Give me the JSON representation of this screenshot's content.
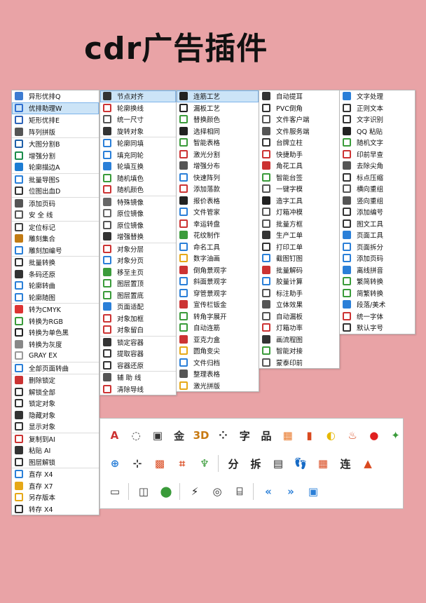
{
  "title": "cdr广告插件",
  "col1": [
    {
      "label": "异形优排Q",
      "icon": "shape-icon",
      "color": "#3d7bd1"
    },
    {
      "label": "优排助理W",
      "icon": "sort-assist-icon",
      "color": "#2f6fd0",
      "sel": true
    },
    {
      "label": "矩形优排E",
      "icon": "rect-sort-icon",
      "color": "#2d63b8"
    },
    {
      "label": "阵列拼版",
      "icon": "array-icon",
      "color": "#555"
    },
    {
      "label": "大图分割B",
      "icon": "split-icon",
      "color": "#1f5fa8"
    },
    {
      "label": "增强分割",
      "icon": "enhanced-split-icon",
      "color": "#1a8c4a"
    },
    {
      "label": "轮廓描边A",
      "icon": "outline-icon",
      "color": "#1d7cd3"
    },
    {
      "label": "批量导图S",
      "icon": "export-icon",
      "color": "#2a7fd8"
    },
    {
      "label": "位图出血D",
      "icon": "bleed-icon",
      "color": "#333"
    },
    {
      "label": "添加页码",
      "icon": "page-number-icon",
      "color": "#555"
    },
    {
      "label": "安 全 线",
      "icon": "safe-line-icon",
      "color": "#555"
    },
    {
      "label": "定位标记",
      "icon": "target-icon",
      "color": "#444"
    },
    {
      "label": "雕刻集合",
      "icon": "engrave-icon",
      "color": "#c27b13"
    },
    {
      "label": "雕刻加编号",
      "icon": "engrave-number-icon",
      "color": "#2a7fd8"
    },
    {
      "label": "批量转换",
      "icon": "batch-convert-icon",
      "color": "#333"
    },
    {
      "label": "条码还原",
      "icon": "barcode-icon",
      "color": "#333"
    },
    {
      "label": "轮廓转曲",
      "icon": "curve-icon",
      "color": "#2a7fd8"
    },
    {
      "label": "轮廓随图",
      "icon": "follow-icon",
      "color": "#2a7fd8"
    },
    {
      "label": "转为CMYK",
      "icon": "cmyk-icon",
      "color": "#d33"
    },
    {
      "label": "转换为RGB",
      "icon": "rgb-icon",
      "color": "#3a9b3a"
    },
    {
      "label": "转换为单色黑",
      "icon": "mono-icon",
      "color": "#222"
    },
    {
      "label": "转换为灰度",
      "icon": "gray-icon",
      "color": "#888"
    },
    {
      "label": "GRAY  EX",
      "icon": "gray-ex-icon",
      "color": "#999"
    },
    {
      "label": "全部页面转曲",
      "icon": "all-pages-icon",
      "color": "#2a7fd8"
    },
    {
      "label": "删除锁定",
      "icon": "delete-lock-icon",
      "color": "#c33"
    },
    {
      "label": "解锁全部",
      "icon": "unlock-icon",
      "color": "#333"
    },
    {
      "label": "锁定对象",
      "icon": "lock-icon",
      "color": "#333"
    },
    {
      "label": "隐藏对象",
      "icon": "hide-icon",
      "color": "#333"
    },
    {
      "label": "显示对象",
      "icon": "show-icon",
      "color": "#333"
    },
    {
      "label": "复制到AI",
      "icon": "copy-ai-icon",
      "color": "#c33"
    },
    {
      "label": "粘贴   AI",
      "icon": "paste-ai-icon",
      "color": "#333"
    },
    {
      "label": "图层解锁",
      "icon": "layer-unlock-icon",
      "color": "#333"
    },
    {
      "label": "直存 X4",
      "icon": "save-x4-icon",
      "color": "#2a7fd8"
    },
    {
      "label": "直存 X7",
      "icon": "save-x7-icon",
      "color": "#e6a817"
    },
    {
      "label": "另存版本",
      "icon": "save-as-icon",
      "color": "#e6a817"
    },
    {
      "label": "转存 X4",
      "icon": "resave-icon",
      "color": "#333"
    }
  ],
  "col2": [
    {
      "label": "节点对齐",
      "icon": "node-align-icon",
      "color": "#333",
      "sel": true
    },
    {
      "label": "轮廓换线",
      "icon": "outline-swap-icon",
      "color": "#c33"
    },
    {
      "label": "统一尺寸",
      "icon": "same-size-icon",
      "color": "#555"
    },
    {
      "label": "旋转对象",
      "icon": "rotate-icon",
      "color": "#333"
    },
    {
      "label": "轮廓同填",
      "icon": "fill-icon",
      "color": "#2a7fd8"
    },
    {
      "label": "填充同轮",
      "icon": "fill-outline-icon",
      "color": "#2a7fd8"
    },
    {
      "label": "轮填互换",
      "icon": "swap-icon",
      "color": "#2a7fd8"
    },
    {
      "label": "随机填色",
      "icon": "random-fill-icon",
      "color": "#3a9b3a"
    },
    {
      "label": "随机颜色",
      "icon": "random-color-icon",
      "color": "#c33"
    },
    {
      "label": "特殊镜像",
      "icon": "mirror-icon",
      "color": "#666"
    },
    {
      "label": "原位镜像",
      "icon": "mirror-inplace-icon",
      "color": "#666"
    },
    {
      "label": "原位镜像",
      "icon": "mirror-inplace-icon",
      "color": "#555"
    },
    {
      "label": "增强替换",
      "icon": "replace-icon",
      "color": "#333"
    },
    {
      "label": "对象分层",
      "icon": "layer-split-icon",
      "color": "#c33"
    },
    {
      "label": "对象分页",
      "icon": "page-split-icon",
      "color": "#2a7fd8"
    },
    {
      "label": "移至主页",
      "icon": "move-master-icon",
      "color": "#3a9b3a"
    },
    {
      "label": "图层置顶",
      "icon": "layer-top-icon",
      "color": "#3a9b3a"
    },
    {
      "label": "图层置底",
      "icon": "layer-bottom-icon",
      "color": "#3a9b3a"
    },
    {
      "label": "页面适配",
      "icon": "page-fit-icon",
      "color": "#2a7fd8"
    },
    {
      "label": "对象加框",
      "icon": "frame-icon",
      "color": "#c33"
    },
    {
      "label": "对象留白",
      "icon": "margin-icon",
      "color": "#c33"
    },
    {
      "label": "锁定容器",
      "icon": "lock-container-icon",
      "color": "#333"
    },
    {
      "label": "提取容器",
      "icon": "extract-container-icon",
      "color": "#333"
    },
    {
      "label": "容器还原",
      "icon": "restore-container-icon",
      "color": "#333"
    },
    {
      "label": "辅 助 线",
      "icon": "guide-icon",
      "color": "#555"
    },
    {
      "label": "清除导线",
      "icon": "clear-guide-icon",
      "color": "#c33"
    }
  ],
  "col3": [
    {
      "label": "连筋工艺",
      "icon": "rib-icon",
      "color": "#222",
      "sel": true
    },
    {
      "label": "漏板工艺",
      "icon": "stencil-icon",
      "color": "#222"
    },
    {
      "label": "替换颜色",
      "icon": "replace-color-icon",
      "color": "#3a9b3a"
    },
    {
      "label": "选择相同",
      "icon": "select-same-icon",
      "color": "#222"
    },
    {
      "label": "智能表格",
      "icon": "table-icon",
      "color": "#3a9b3a"
    },
    {
      "label": "激光分割",
      "icon": "laser-split-icon",
      "color": "#c33"
    },
    {
      "label": "增强分布",
      "icon": "distribute-icon",
      "color": "#555"
    },
    {
      "label": "快速阵列",
      "icon": "quick-array-icon",
      "color": "#2a7fd8"
    },
    {
      "label": "添加落款",
      "icon": "signature-icon",
      "color": "#c33"
    },
    {
      "label": "报价表格",
      "icon": "quote-icon",
      "color": "#222"
    },
    {
      "label": "文件管家",
      "icon": "file-manager-icon",
      "color": "#2a7fd8"
    },
    {
      "label": "幸运转盘",
      "icon": "wheel-icon",
      "color": "#c33"
    },
    {
      "label": "花纹制作",
      "icon": "pattern-icon",
      "color": "#3a9b3a"
    },
    {
      "label": "命名工具",
      "icon": "name-tool-icon",
      "color": "#2a7fd8"
    },
    {
      "label": "数字油画",
      "icon": "paint-icon",
      "color": "#e6a817"
    },
    {
      "label": "倒角景观字",
      "icon": "bevel-text-icon",
      "color": "#c33"
    },
    {
      "label": "斜面景观字",
      "icon": "slope-text-icon",
      "color": "#2a7fd8"
    },
    {
      "label": "穿管景观字",
      "icon": "pipe-text-icon",
      "color": "#2a7fd8"
    },
    {
      "label": "宣传栏钣金",
      "icon": "sheet-metal-icon",
      "color": "#c33"
    },
    {
      "label": "转角字展开",
      "icon": "corner-text-icon",
      "color": "#3a9b3a"
    },
    {
      "label": "自动连筋",
      "icon": "auto-rib-icon",
      "color": "#3a9b3a"
    },
    {
      "label": "亚克力盒",
      "icon": "acrylic-icon",
      "color": "#c33"
    },
    {
      "label": "圆角变尖",
      "icon": "round-corner-icon",
      "color": "#e6a817"
    },
    {
      "label": "文件归档",
      "icon": "archive-icon",
      "color": "#2a7fd8"
    },
    {
      "label": "整理表格",
      "icon": "sort-table-icon",
      "color": "#555"
    },
    {
      "label": "激光拼版",
      "icon": "laser-layout-icon",
      "color": "#e6a817"
    }
  ],
  "col4": [
    {
      "label": "自动提耳",
      "icon": "auto-ear-icon",
      "color": "#333"
    },
    {
      "label": "PVC倒角",
      "icon": "pvc-icon",
      "color": "#333"
    },
    {
      "label": "文件客户端",
      "icon": "client-icon",
      "color": "#555"
    },
    {
      "label": "文件服务端",
      "icon": "server-icon",
      "color": "#555"
    },
    {
      "label": "台牌立柱",
      "icon": "pillar-icon",
      "color": "#333"
    },
    {
      "label": "快捷助手",
      "icon": "assistant-icon",
      "color": "#c33"
    },
    {
      "label": "角花工具",
      "icon": "corner-flower-icon",
      "color": "#c33"
    },
    {
      "label": "智能台签",
      "icon": "table-card-icon",
      "color": "#3a9b3a"
    },
    {
      "label": "一键字模",
      "icon": "font-mold-icon",
      "color": "#555"
    },
    {
      "label": "造字工具",
      "icon": "font-tool-icon",
      "color": "#222"
    },
    {
      "label": "灯箱冲模",
      "icon": "lightbox-icon",
      "color": "#555"
    },
    {
      "label": "批量方框",
      "icon": "batch-box-icon",
      "color": "#555"
    },
    {
      "label": "生产工单",
      "icon": "work-order-icon",
      "color": "#333"
    },
    {
      "label": "打印工单",
      "icon": "print-order-icon",
      "color": "#333"
    },
    {
      "label": "截图钉图",
      "icon": "screenshot-icon",
      "color": "#2a7fd8"
    },
    {
      "label": "批量解码",
      "icon": "decode-icon",
      "color": "#c33"
    },
    {
      "label": "胶量计算",
      "icon": "glue-icon",
      "color": "#2a7fd8"
    },
    {
      "label": "标注助手",
      "icon": "annotate-icon",
      "color": "#555"
    },
    {
      "label": "立体效果",
      "icon": "3d-icon",
      "color": "#555"
    },
    {
      "label": "自动漏板",
      "icon": "auto-stencil-icon",
      "color": "#555"
    },
    {
      "label": "灯箱功率",
      "icon": "power-icon",
      "color": "#c33"
    },
    {
      "label": "画流程图",
      "icon": "flowchart-icon",
      "color": "#333"
    },
    {
      "label": "智能对接",
      "icon": "connect-icon",
      "color": "#3a9b3a"
    },
    {
      "label": "蒙泰印前",
      "icon": "prepress-icon",
      "color": "#555"
    }
  ],
  "col5": [
    {
      "label": "文字处理",
      "icon": "text-process-icon",
      "color": "#2a7fd8"
    },
    {
      "label": "正则文本",
      "icon": "regex-icon",
      "color": "#333"
    },
    {
      "label": "文字识别",
      "icon": "ocr-icon",
      "color": "#333"
    },
    {
      "label": "QQ 粘贴",
      "icon": "qq-icon",
      "color": "#222"
    },
    {
      "label": "随机文字",
      "icon": "random-text-icon",
      "color": "#3a9b3a"
    },
    {
      "label": "印前早查",
      "icon": "precheck-icon",
      "color": "#c33"
    },
    {
      "label": "去除尖角",
      "icon": "sharp-corner-icon",
      "color": "#555"
    },
    {
      "label": "标点压缩",
      "icon": "punctuation-icon",
      "color": "#333"
    },
    {
      "label": "横向重组",
      "icon": "horizontal-icon",
      "color": "#555"
    },
    {
      "label": "竖向重组",
      "icon": "vertical-icon",
      "color": "#555"
    },
    {
      "label": "添加编号",
      "icon": "numbering-icon",
      "color": "#333"
    },
    {
      "label": "图文工具",
      "icon": "text-tool-icon",
      "color": "#333"
    },
    {
      "label": "页面工具",
      "icon": "page-tool-icon",
      "color": "#2a7fd8"
    },
    {
      "label": "页面拆分",
      "icon": "page-split2-icon",
      "color": "#2a7fd8"
    },
    {
      "label": "添加页码",
      "icon": "add-page-icon",
      "color": "#2a7fd8"
    },
    {
      "label": "离线拼音",
      "icon": "pinyin-icon",
      "color": "#2a7fd8"
    },
    {
      "label": "繁简转换",
      "icon": "trad-simp-icon",
      "color": "#3a9b3a"
    },
    {
      "label": "简繁转换",
      "icon": "simp-trad-icon",
      "color": "#3a9b3a"
    },
    {
      "label": "段落/美术",
      "icon": "paragraph-icon",
      "color": "#2a7fd8"
    },
    {
      "label": "统一字体",
      "icon": "unify-font-icon",
      "color": "#c33"
    },
    {
      "label": "默认字号",
      "icon": "font-size-icon",
      "color": "#333"
    }
  ],
  "toolbar": {
    "row1": [
      {
        "glyph": "A",
        "icon": "pen-tool-icon",
        "color": "#c33"
      },
      {
        "glyph": "◌",
        "icon": "circle-dots-icon",
        "color": "#333"
      },
      {
        "glyph": "▣",
        "icon": "image-icon",
        "color": "#333"
      },
      {
        "glyph": "金",
        "icon": "gold-text-icon",
        "color": "#333"
      },
      {
        "glyph": "3D",
        "icon": "3d-text-icon",
        "color": "#c87a13"
      },
      {
        "glyph": "⁘",
        "icon": "dice-icon",
        "color": "#222"
      },
      {
        "glyph": "字",
        "icon": "character-icon",
        "color": "#222"
      },
      {
        "glyph": "品",
        "icon": "grid-text-icon",
        "color": "#222"
      },
      {
        "glyph": "▦",
        "icon": "orange-square-icon",
        "color": "#e8792b"
      },
      {
        "glyph": "▮",
        "icon": "tag-icon",
        "color": "#d9491f"
      },
      {
        "glyph": "◐",
        "icon": "yellow-face-icon",
        "color": "#e6b800"
      },
      {
        "glyph": "♨",
        "icon": "balloon-icon",
        "color": "#d9491f"
      },
      {
        "glyph": "●",
        "icon": "red-dot-icon",
        "color": "#e02020"
      },
      {
        "glyph": "✦",
        "icon": "color-star-icon",
        "color": "#3a9b3a"
      }
    ],
    "row2": [
      {
        "glyph": "⊕",
        "icon": "globe-icon",
        "color": "#2a7fd8"
      },
      {
        "glyph": "⊹",
        "icon": "crosshair-icon",
        "color": "#333"
      },
      {
        "glyph": "▩",
        "icon": "mosaic-icon",
        "color": "#d9491f"
      },
      {
        "glyph": "⌗",
        "icon": "crop-icon",
        "color": "#d9491f"
      },
      {
        "glyph": "♆",
        "icon": "plant-icon",
        "color": "#3a9b3a"
      },
      {
        "glyph": "分",
        "icon": "split-text-icon",
        "color": "#222"
      },
      {
        "glyph": "拆",
        "icon": "break-text-icon",
        "color": "#222"
      },
      {
        "glyph": "▤",
        "icon": "comment-icon",
        "color": "#222"
      },
      {
        "glyph": "👣",
        "icon": "footprint-icon",
        "color": "#d9491f"
      },
      {
        "glyph": "▦",
        "icon": "red-grid-icon",
        "color": "#d9491f"
      },
      {
        "glyph": "连",
        "icon": "connect-text-icon",
        "color": "#222"
      },
      {
        "glyph": "▲",
        "icon": "pagoda-icon",
        "color": "#d9491f"
      }
    ],
    "row3": [
      {
        "glyph": "▭",
        "icon": "printer-icon",
        "color": "#333"
      },
      {
        "glyph": "◫",
        "icon": "ruler-icon",
        "color": "#333"
      },
      {
        "glyph": "⬤",
        "icon": "color-circles-icon",
        "color": "#3a9b3a"
      },
      {
        "glyph": "⚡",
        "icon": "tool-icon",
        "color": "#222"
      },
      {
        "glyph": "◎",
        "icon": "spiral-icon",
        "color": "#333"
      },
      {
        "glyph": "⌸",
        "icon": "barcode-tool-icon",
        "color": "#555"
      },
      {
        "glyph": "«",
        "icon": "rewind-icon",
        "color": "#2a7fd8"
      },
      {
        "glyph": "»",
        "icon": "forward-icon",
        "color": "#2a7fd8"
      },
      {
        "glyph": "▣",
        "icon": "monitor-icon",
        "color": "#2a7fd8"
      }
    ]
  }
}
